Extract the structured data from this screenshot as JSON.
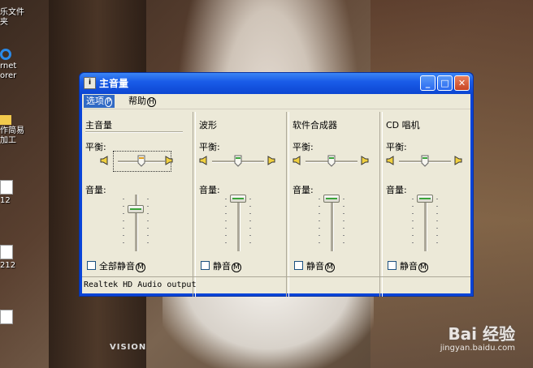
{
  "desktop": {
    "icons": [
      {
        "label": "乐文件\n夹"
      },
      {
        "label": "rnet\norer"
      },
      {
        "label": "作简易\n加工"
      },
      {
        "label": "12"
      },
      {
        "label": "212"
      },
      {
        "label": ""
      }
    ],
    "brand": "VISION",
    "watermark": "Bai 经验",
    "watermark_url": "jingyan.baidu.com"
  },
  "window": {
    "title": "主音量",
    "menu": [
      {
        "label": "选项",
        "key": "P"
      },
      {
        "label": "帮助",
        "key": "H"
      }
    ],
    "balance_label": "平衡:",
    "volume_label": "音量:",
    "panels": [
      {
        "title": "主音量",
        "mute_label": "全部静音",
        "mute_key": "M",
        "muted": false,
        "balance": 0.5,
        "volume": 0.78
      },
      {
        "title": "波形",
        "mute_label": "静音",
        "mute_key": "M",
        "muted": false,
        "balance": 0.5,
        "volume": 1.0
      },
      {
        "title": "软件合成器",
        "mute_label": "静音",
        "mute_key": "M",
        "muted": false,
        "balance": 0.5,
        "volume": 1.0
      },
      {
        "title": "CD 唱机",
        "mute_label": "静音",
        "mute_key": "M",
        "muted": false,
        "balance": 0.5,
        "volume": 1.0
      }
    ],
    "status": "Realtek HD Audio output"
  }
}
